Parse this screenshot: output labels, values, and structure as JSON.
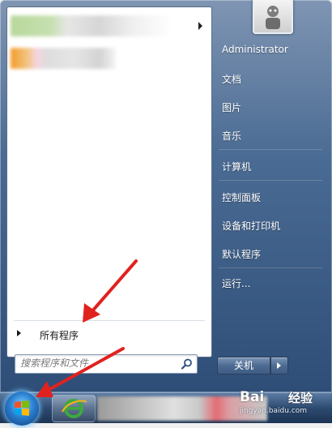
{
  "start_menu": {
    "pinned": [
      {
        "label": "",
        "has_submenu": true
      },
      {
        "label": "",
        "has_submenu": false
      }
    ],
    "all_programs_label": "所有程序",
    "search": {
      "placeholder": "搜索程序和文件"
    },
    "right_pane": {
      "items": [
        {
          "id": "administrator",
          "label": "Administrator"
        },
        {
          "id": "documents",
          "label": "文档"
        },
        {
          "id": "pictures",
          "label": "图片"
        },
        {
          "id": "music",
          "label": "音乐"
        },
        {
          "id": "computer",
          "label": "计算机"
        },
        {
          "id": "control-panel",
          "label": "控制面板"
        },
        {
          "id": "devices",
          "label": "设备和打印机"
        },
        {
          "id": "default-programs",
          "label": "默认程序"
        },
        {
          "id": "run",
          "label": "运行..."
        }
      ]
    },
    "shutdown_label": "关机"
  },
  "watermark": {
    "brand": "Bai",
    "tail": "经验",
    "site": "jingyan.baidu.com"
  },
  "colors": {
    "annotation_arrow": "#e0221f",
    "menu_blue": "#4a6b93",
    "taskbar_blue": "#2d4a70"
  }
}
